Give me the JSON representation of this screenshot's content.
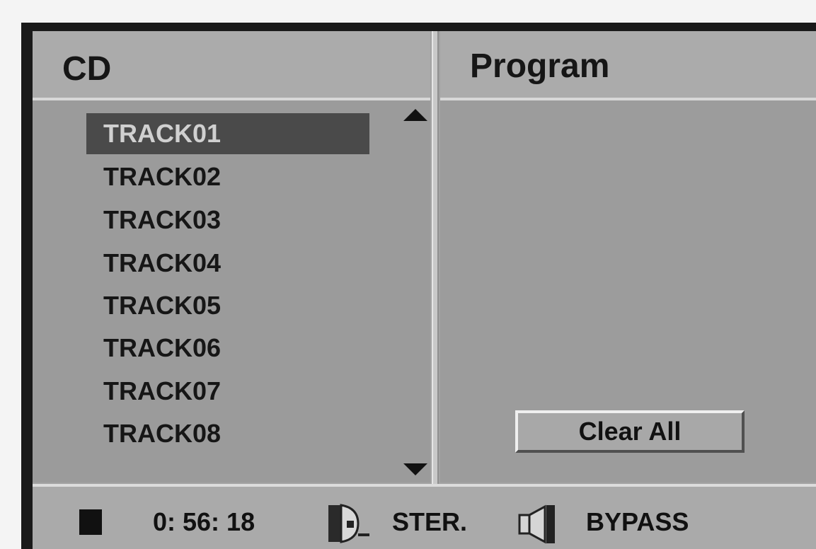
{
  "headers": {
    "cd": "CD",
    "program": "Program"
  },
  "tracks": [
    {
      "label": "TRACK01",
      "selected": true
    },
    {
      "label": "TRACK02",
      "selected": false
    },
    {
      "label": "TRACK03",
      "selected": false
    },
    {
      "label": "TRACK04",
      "selected": false
    },
    {
      "label": "TRACK05",
      "selected": false
    },
    {
      "label": "TRACK06",
      "selected": false
    },
    {
      "label": "TRACK07",
      "selected": false
    },
    {
      "label": "TRACK08",
      "selected": false
    }
  ],
  "program": {
    "clear_label": "Clear All"
  },
  "status": {
    "state_icon": "stop-icon",
    "time": "0: 56: 18",
    "audio_icon": "disc-audio-icon",
    "audio_mode": "STER.",
    "speaker_icon": "speaker-icon",
    "output_mode": "BYPASS"
  },
  "colors": {
    "panel": "#a3a3a3",
    "selection": "#4a4a4a",
    "text": "#161616"
  }
}
